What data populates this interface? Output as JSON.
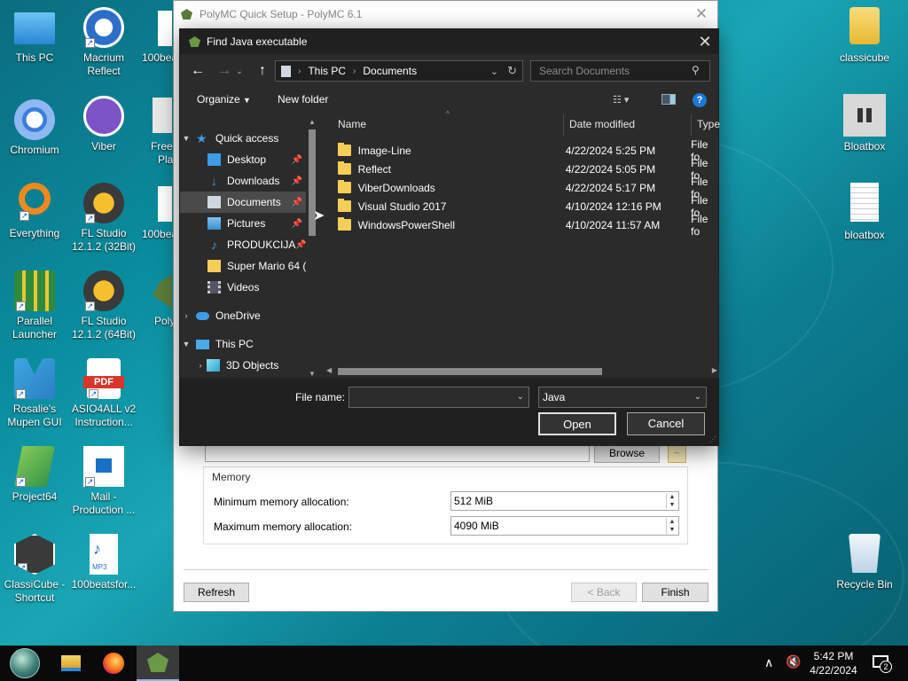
{
  "desktop": {
    "left_icons": [
      {
        "id": "this-pc",
        "label": "This PC",
        "color": "#4aa9e8"
      },
      {
        "id": "macrium",
        "label": "Macrium Reflect",
        "color": "#2d6ec8"
      },
      {
        "id": "chromium",
        "label": "Chromium",
        "color": "#3b7ddd"
      },
      {
        "id": "viber",
        "label": "Viber",
        "color": "#7d53c8"
      },
      {
        "id": "everything",
        "label": "Everything",
        "color": "#f08a1c"
      },
      {
        "id": "fl32",
        "label": "FL Studio 12.1.2 (32Bit)",
        "color": "#f4a51d"
      },
      {
        "id": "parallel",
        "label": "Parallel Launcher",
        "color": "#2e8b3d"
      },
      {
        "id": "fl64",
        "label": "FL Studio 12.1.2 (64Bit)",
        "color": "#f4a51d"
      },
      {
        "id": "rosalie",
        "label": "Rosalie's Mupen GUI",
        "color": "#3fa6e0"
      },
      {
        "id": "asio",
        "label": "ASIO4ALL v2 Instruction...",
        "color": "#d9362b"
      },
      {
        "id": "project64",
        "label": "Project64",
        "color": "#2e8f46"
      },
      {
        "id": "mail",
        "label": "Mail - Production ...",
        "color": "#1a6fc6"
      },
      {
        "id": "classicube",
        "label": "ClassiCube - Shortcut",
        "color": "#4a4a4a"
      },
      {
        "id": "mp3",
        "label": "100beatsfor...",
        "color": "#2a6fc8"
      }
    ],
    "partial_labels": [
      "100bea",
      "Free",
      "Pla",
      "100bea",
      "Poly"
    ],
    "right_icons": [
      {
        "id": "classicube-folder",
        "label": "classicube"
      },
      {
        "id": "bloatbox-app",
        "label": "Bloatbox"
      },
      {
        "id": "bloatbox-file",
        "label": "bloatbox"
      },
      {
        "id": "recycle-bin",
        "label": "Recycle Bin"
      }
    ]
  },
  "polymc": {
    "title": "PolyMC Quick Setup - PolyMC 6.1",
    "browse_label": "Browse",
    "memory_group": "Memory",
    "min_label": "Minimum memory allocation:",
    "min_value": "512 MiB",
    "max_label": "Maximum memory allocation:",
    "max_value": "4090 MiB",
    "refresh_label": "Refresh",
    "back_label": "< Back",
    "finish_label": "Finish"
  },
  "dialog": {
    "title": "Find Java executable",
    "breadcrumb": [
      "This PC",
      "Documents"
    ],
    "search_placeholder": "Search Documents",
    "organize_label": "Organize",
    "new_folder_label": "New folder",
    "tree": [
      {
        "label": "Quick access",
        "icon": "star",
        "level": 0,
        "expanded": true
      },
      {
        "label": "Desktop",
        "icon": "desktop",
        "level": 1,
        "pinned": true
      },
      {
        "label": "Downloads",
        "icon": "download",
        "level": 1,
        "pinned": true
      },
      {
        "label": "Documents",
        "icon": "document",
        "level": 1,
        "pinned": true,
        "selected": true
      },
      {
        "label": "Pictures",
        "icon": "picture",
        "level": 1,
        "pinned": true
      },
      {
        "label": "PRODUKCIJA",
        "icon": "music",
        "level": 1,
        "pinned": true
      },
      {
        "label": "Super Mario 64 (",
        "icon": "folder",
        "level": 1
      },
      {
        "label": "Videos",
        "icon": "video",
        "level": 1
      },
      {
        "label": "OneDrive",
        "icon": "cloud",
        "level": 0,
        "expanded": false
      },
      {
        "label": "This PC",
        "icon": "pc",
        "level": 0,
        "expanded": true
      },
      {
        "label": "3D Objects",
        "icon": "cube",
        "level": 1,
        "expanded": false
      }
    ],
    "columns": {
      "name": "Name",
      "date": "Date modified",
      "type": "Type"
    },
    "files": [
      {
        "name": "Image-Line",
        "date": "4/22/2024 5:25 PM",
        "type": "File fo"
      },
      {
        "name": "Reflect",
        "date": "4/22/2024 5:05 PM",
        "type": "File fo"
      },
      {
        "name": "ViberDownloads",
        "date": "4/22/2024 5:17 PM",
        "type": "File fo"
      },
      {
        "name": "Visual Studio 2017",
        "date": "4/10/2024 12:16 PM",
        "type": "File fo"
      },
      {
        "name": "WindowsPowerShell",
        "date": "4/10/2024 11:57 AM",
        "type": "File fo"
      }
    ],
    "filename_label": "File name:",
    "filename_value": "",
    "filter_value": "Java",
    "open_label": "Open",
    "cancel_label": "Cancel"
  },
  "taskbar": {
    "time": "5:42 PM",
    "date": "4/22/2024",
    "notifications": "2"
  }
}
